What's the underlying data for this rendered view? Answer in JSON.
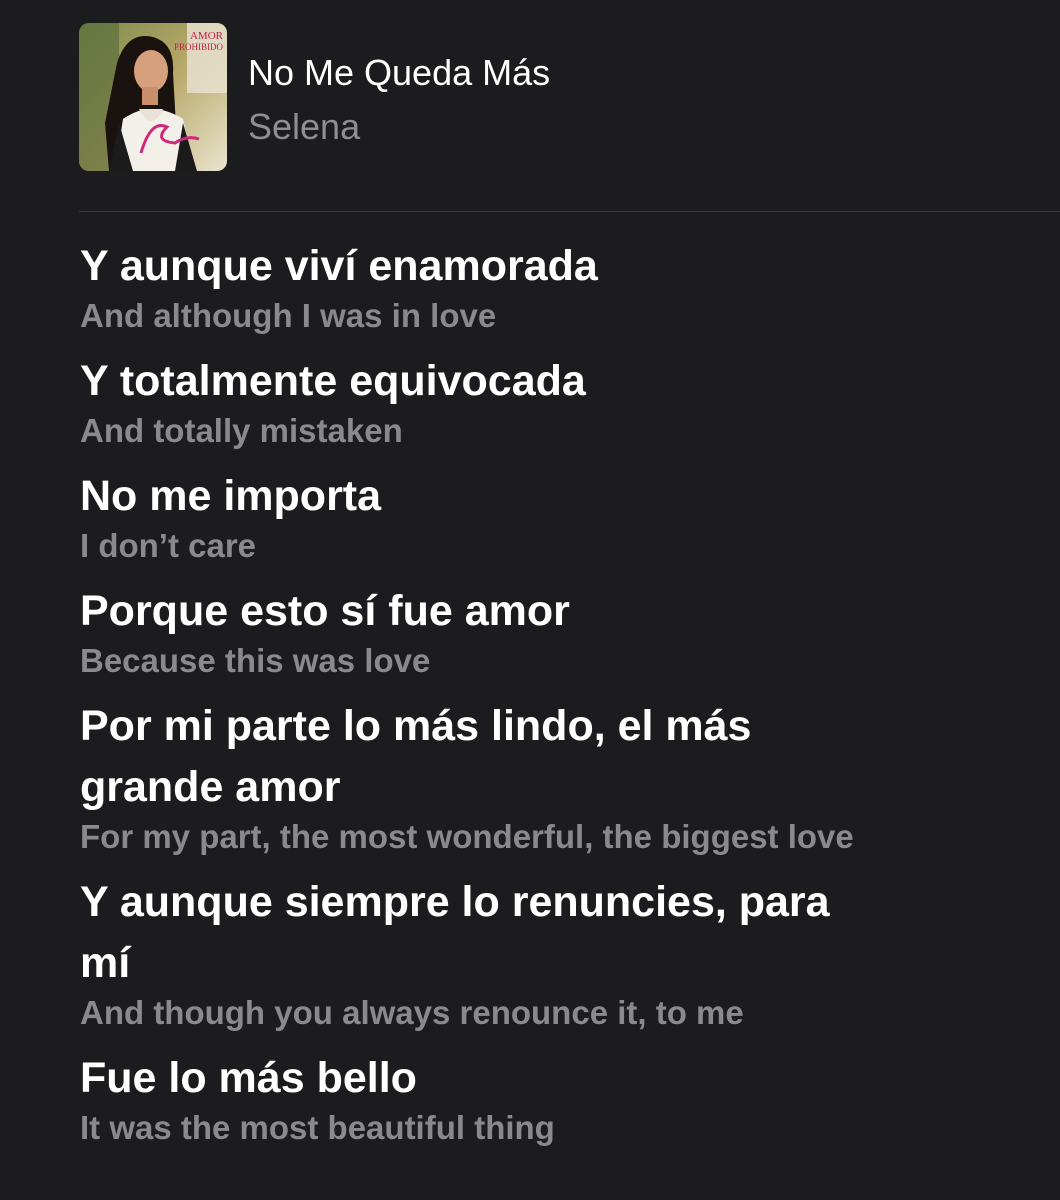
{
  "header": {
    "album_art": {
      "icon": "album-cover-image",
      "lettering": [
        "AMOR",
        "PROHIBIDO",
        "Selena"
      ]
    },
    "title": "No Me Queda Más",
    "artist": "Selena"
  },
  "colors": {
    "background": "#1c1c1e",
    "primary_text": "#ffffff",
    "secondary_text": "#8a8a8e",
    "divider": "#3a3a3c"
  },
  "lyrics": [
    {
      "original": "Y aunque viví enamorada",
      "translation": "And although I was in love"
    },
    {
      "original": "Y totalmente equivocada",
      "translation": "And totally mistaken"
    },
    {
      "original": "No me importa",
      "translation": "I don’t care"
    },
    {
      "original": "Porque esto sí fue amor",
      "translation": "Because this was love"
    },
    {
      "original": "Por mi parte lo más lindo, el más grande amor",
      "translation": "For my part, the most wonderful, the biggest love"
    },
    {
      "original": "Y aunque siempre lo renuncies, para mí",
      "translation": "And though you always renounce it, to me"
    },
    {
      "original": "Fue lo más bello",
      "translation": "It was the most beautiful thing"
    }
  ]
}
